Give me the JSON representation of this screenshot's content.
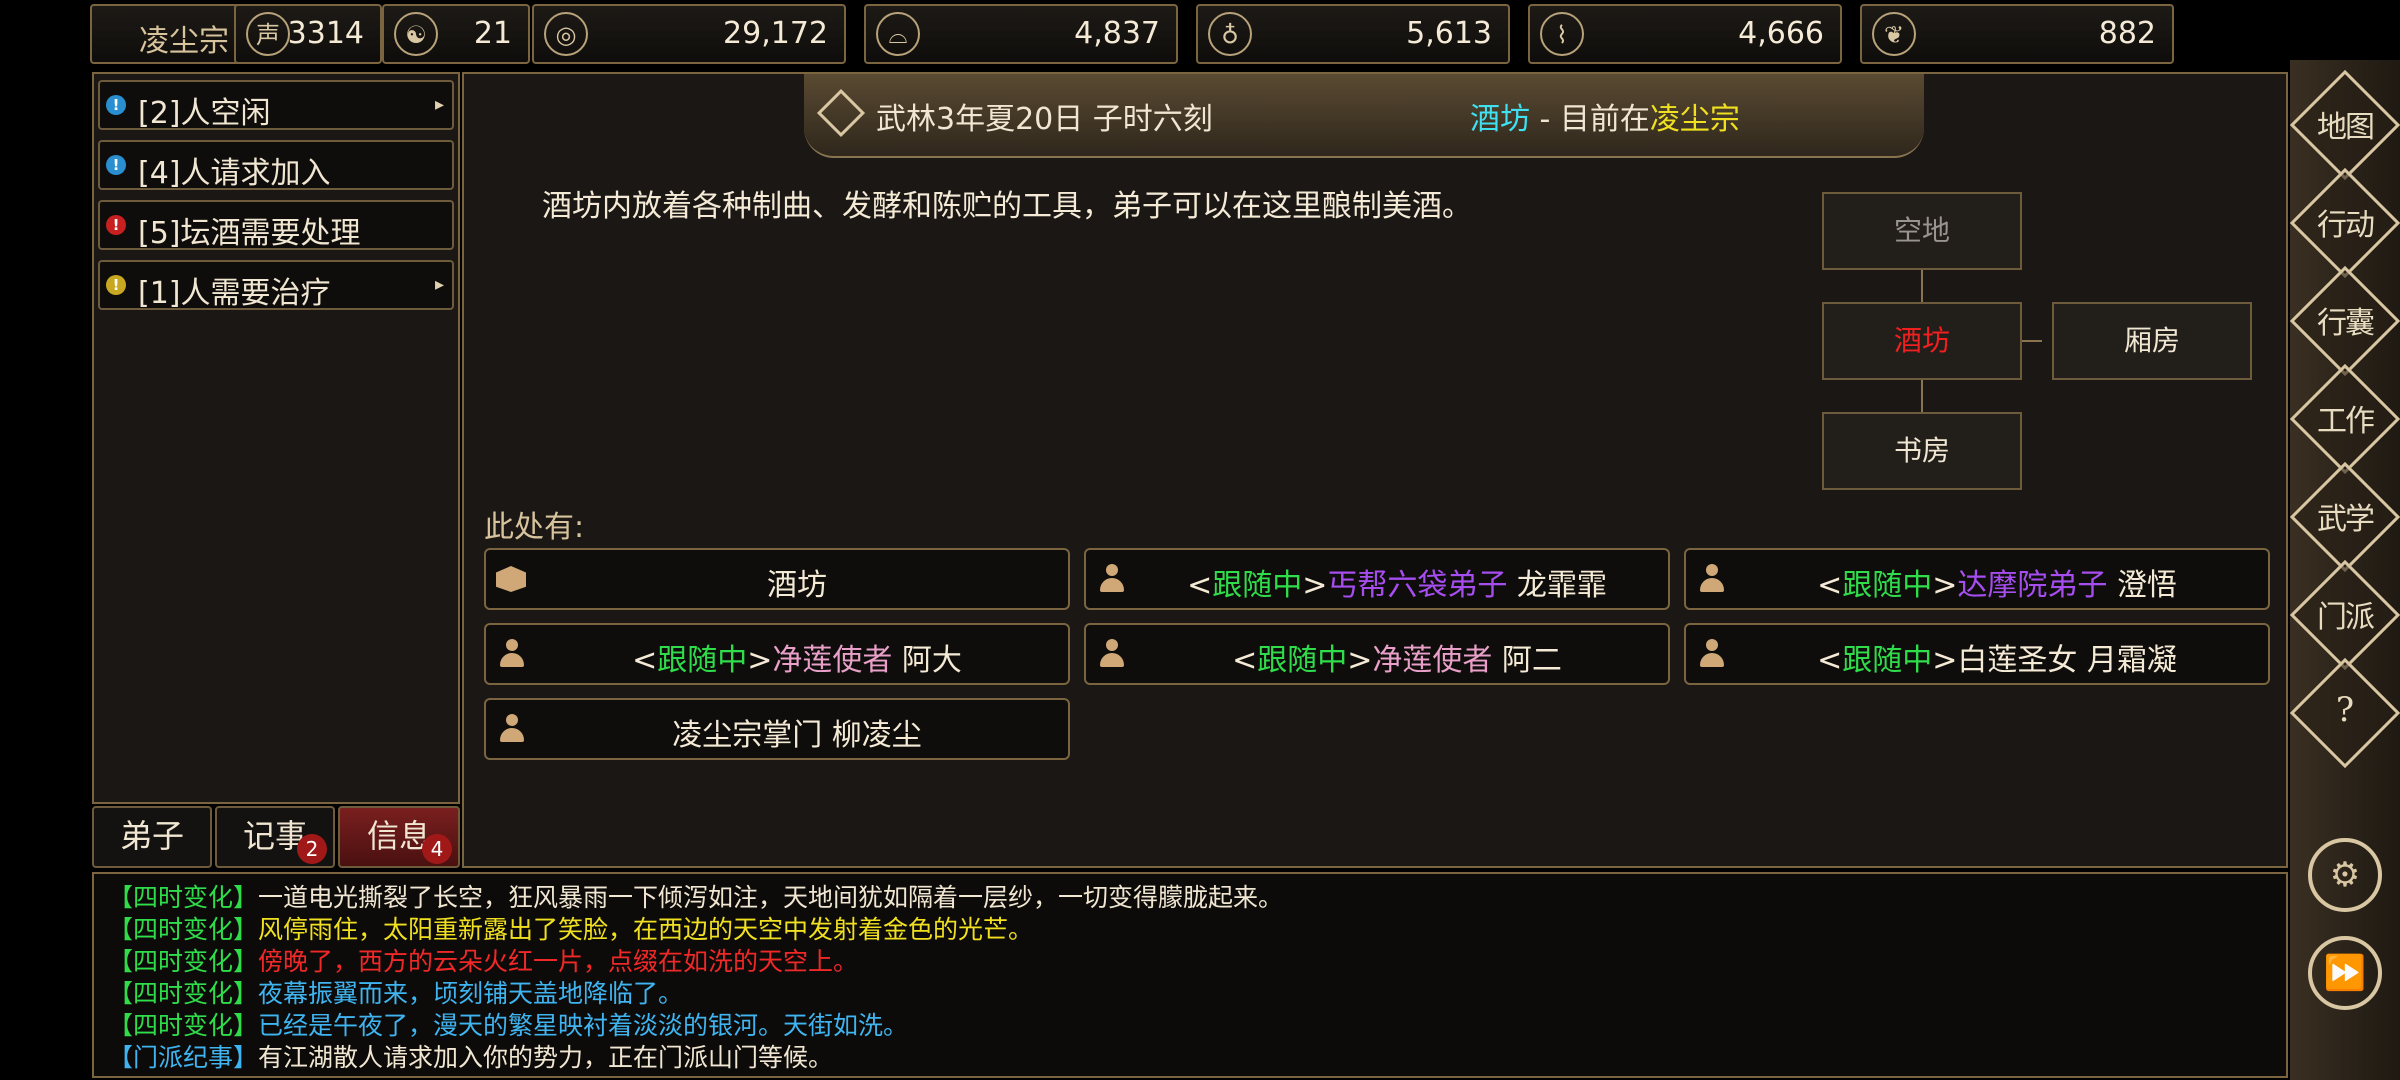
{
  "topbar": {
    "sect_name": "凌尘宗",
    "resources": [
      {
        "icon": "prestige-icon",
        "glyph": "声",
        "value": "3314"
      },
      {
        "icon": "yinyang-icon",
        "glyph": "☯",
        "value": "21"
      },
      {
        "icon": "coin-icon",
        "glyph": "◎",
        "value": "29,172"
      },
      {
        "icon": "food-bowl-icon",
        "glyph": "⌓",
        "value": "4,837"
      },
      {
        "icon": "wine-gourd-icon",
        "glyph": "♁",
        "value": "5,613"
      },
      {
        "icon": "wood-log-icon",
        "glyph": "⌇",
        "value": "4,666"
      },
      {
        "icon": "herb-icon",
        "glyph": "❦",
        "value": "882"
      }
    ]
  },
  "tasks": [
    {
      "text": "[2]人空闲",
      "dot_color": "#2a8fd0",
      "arrow": "▸"
    },
    {
      "text": "[4]人请求加入",
      "dot_color": "#2a8fd0",
      "arrow": ""
    },
    {
      "text": "[5]坛酒需要处理",
      "dot_color": "#c82020",
      "arrow": ""
    },
    {
      "text": "[1]人需要治疗",
      "dot_color": "#c8a820",
      "arrow": "▸"
    }
  ],
  "left_tabs": [
    {
      "label": "弟子",
      "badge": ""
    },
    {
      "label": "记事",
      "badge": "2"
    },
    {
      "label": "信息",
      "badge": "4"
    }
  ],
  "header": {
    "date": "武林3年夏20日 子时六刻",
    "location_name": "酒坊",
    "separator": " - ",
    "location_prefix": "目前在",
    "sect": "凌尘宗"
  },
  "description": "酒坊内放着各种制曲、发酵和陈贮的工具，弟子可以在这里酿制美酒。",
  "minimap": {
    "north": "空地",
    "current": "酒坊",
    "east": "厢房",
    "south": "书房"
  },
  "here_label": "此处有:",
  "entities": [
    {
      "kind": "building",
      "parts": [
        {
          "t": "酒坊",
          "c": ""
        }
      ]
    },
    {
      "kind": "person",
      "parts": [
        {
          "t": "<",
          "c": ""
        },
        {
          "t": "跟随中",
          "c": "c-green"
        },
        {
          "t": ">",
          "c": ""
        },
        {
          "t": "丐帮六袋弟子",
          "c": "c-purple"
        },
        {
          "t": " 龙霏霏",
          "c": ""
        }
      ]
    },
    {
      "kind": "person",
      "parts": [
        {
          "t": "<",
          "c": ""
        },
        {
          "t": "跟随中",
          "c": "c-green"
        },
        {
          "t": ">",
          "c": ""
        },
        {
          "t": "达摩院弟子",
          "c": "c-purple"
        },
        {
          "t": " 澄悟",
          "c": ""
        }
      ]
    },
    {
      "kind": "person",
      "parts": [
        {
          "t": "<",
          "c": ""
        },
        {
          "t": "跟随中",
          "c": "c-green"
        },
        {
          "t": ">",
          "c": ""
        },
        {
          "t": "净莲使者",
          "c": "c-pink"
        },
        {
          "t": " 阿大",
          "c": ""
        }
      ]
    },
    {
      "kind": "person",
      "parts": [
        {
          "t": "<",
          "c": ""
        },
        {
          "t": "跟随中",
          "c": "c-green"
        },
        {
          "t": ">",
          "c": ""
        },
        {
          "t": "净莲使者",
          "c": "c-pink"
        },
        {
          "t": " 阿二",
          "c": ""
        }
      ]
    },
    {
      "kind": "person",
      "parts": [
        {
          "t": "<",
          "c": ""
        },
        {
          "t": "跟随中",
          "c": "c-green"
        },
        {
          "t": ">",
          "c": ""
        },
        {
          "t": "白莲圣女 月霜凝",
          "c": ""
        }
      ]
    },
    {
      "kind": "person",
      "parts": [
        {
          "t": "凌尘宗掌门 柳凌尘",
          "c": ""
        }
      ]
    }
  ],
  "right_nav": [
    {
      "label": "地图",
      "icon": "map-icon"
    },
    {
      "label": "行动",
      "icon": "action-icon"
    },
    {
      "label": "行囊",
      "icon": "bag-icon"
    },
    {
      "label": "工作",
      "icon": "work-icon"
    },
    {
      "label": "武学",
      "icon": "martial-icon"
    },
    {
      "label": "门派",
      "icon": "sect-icon"
    },
    {
      "label": "?",
      "icon": "help-icon"
    }
  ],
  "log": [
    {
      "tag": "【四时变化】",
      "tag_color": "#2fdc4a",
      "text": "一道电光撕裂了长空，狂风暴雨一下倾泻如注，天地间犹如隔着一层纱，一切变得朦胧起来。",
      "color": "#f0e6d2"
    },
    {
      "tag": "【四时变化】",
      "tag_color": "#2fdc4a",
      "text": "风停雨住，太阳重新露出了笑脸，在西边的天空中发射着金色的光芒。",
      "color": "#f0e020"
    },
    {
      "tag": "【四时变化】",
      "tag_color": "#2fdc4a",
      "text": "傍晚了，西方的云朵火红一片，点缀在如洗的天空上。",
      "color": "#f02828"
    },
    {
      "tag": "【四时变化】",
      "tag_color": "#2fdc4a",
      "text": "夜幕振翼而来，顷刻铺天盖地降临了。",
      "color": "#3fb4f0"
    },
    {
      "tag": "【四时变化】",
      "tag_color": "#2fdc4a",
      "text": "已经是午夜了，漫天的繁星映衬着淡淡的银河。天街如洗。",
      "color": "#3fb4f0"
    },
    {
      "tag": "【门派纪事】",
      "tag_color": "#3fb4f0",
      "text": "有江湖散人请求加入你的势力，正在门派山门等候。",
      "color": "#f0e6d2"
    }
  ]
}
